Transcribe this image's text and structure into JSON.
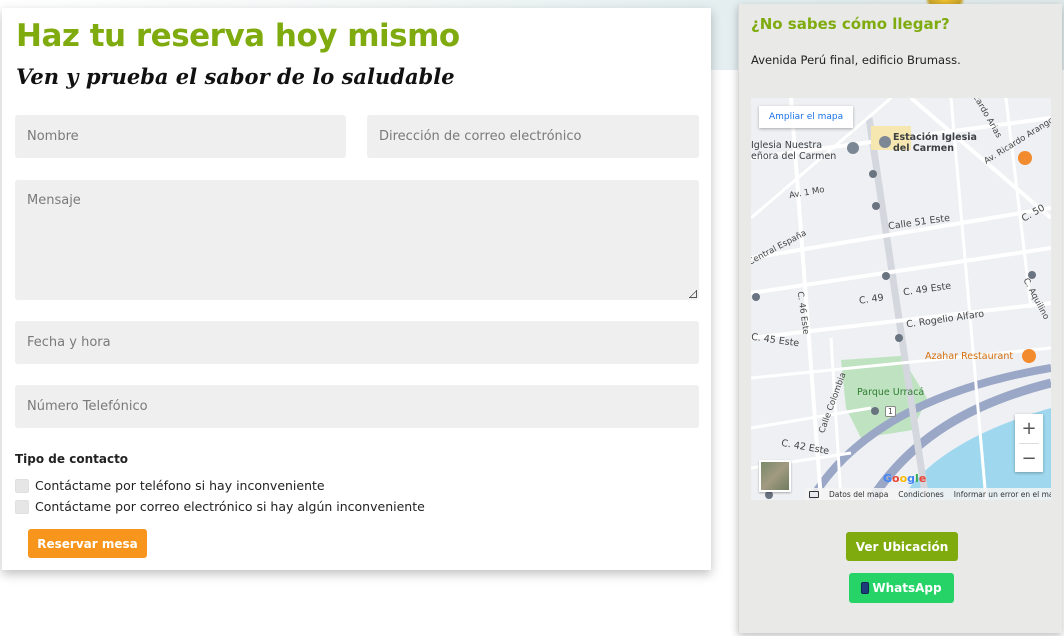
{
  "form": {
    "title": "Haz tu reserva hoy mismo",
    "subtitle": "Ven y prueba el sabor de lo saludable",
    "fields": {
      "nombre_placeholder": "Nombre",
      "email_placeholder": "Dirección de correo electrónico",
      "mensaje_placeholder": "Mensaje",
      "fecha_placeholder": "Fecha y hora",
      "telefono_placeholder": "Número Telefónico"
    },
    "contact_type_label": "Tipo de contacto",
    "contact_options": [
      "Contáctame por teléfono si hay inconveniente",
      "Contáctame por correo electrónico si hay algún inconveniente"
    ],
    "submit_label": "Reservar mesa"
  },
  "location": {
    "title": "¿No sabes cómo llegar?",
    "address": "Avenida Perú final, edificio Brumass.",
    "map": {
      "expand_label": "Ampliar el mapa",
      "labels": {
        "church": "Iglesia Nuestra\neñora del Carmen",
        "station": "Estación Iglesia\ndel Carmen",
        "av_ricardo": "Av. Ricardo Arango",
        "ricardo_arias": "Ricardo Arias",
        "av1": "Av. 1 Mo",
        "calle51": "Calle 51 Este",
        "c50": "C. 50",
        "central_espana": "Central España",
        "c49": "C. 49",
        "c49este": "C. 49 Este",
        "c46": "C. 46 Este",
        "aquilino": "C. Aquilino",
        "rogelio": "C. Rogelio Alfaro",
        "c45": "C. 45 Este",
        "azahar": "Azahar Restaurant",
        "parque": "Parque Urracá",
        "calle_colombia": "Calle Colombia",
        "c42": "C. 42 Este",
        "route_badge": "1"
      },
      "zoom_in": "+",
      "zoom_out": "−",
      "google": "Google",
      "footer": [
        "Datos del mapa",
        "Condiciones",
        "Informar un error en el mapa"
      ]
    },
    "location_button": "Ver Ubicación",
    "whatsapp_button": "WhatsApp"
  },
  "colors": {
    "brand_green": "#7fab0f",
    "reserve_orange": "#f7951d",
    "whatsapp_green": "#25d366"
  }
}
